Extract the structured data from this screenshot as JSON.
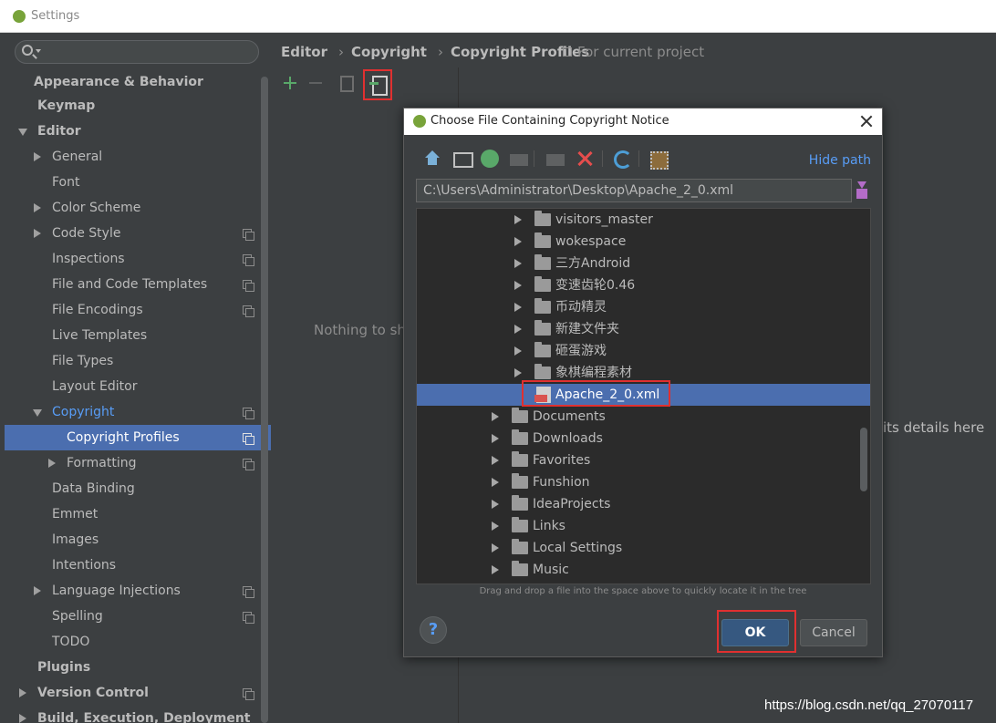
{
  "window": {
    "title": "Settings"
  },
  "sidebar": {
    "items": [
      {
        "label": "Appearance & Behavior"
      },
      {
        "label": "Keymap"
      },
      {
        "label": "Editor"
      },
      {
        "label": "General"
      },
      {
        "label": "Font"
      },
      {
        "label": "Color Scheme"
      },
      {
        "label": "Code Style"
      },
      {
        "label": "Inspections"
      },
      {
        "label": "File and Code Templates"
      },
      {
        "label": "File Encodings"
      },
      {
        "label": "Live Templates"
      },
      {
        "label": "File Types"
      },
      {
        "label": "Layout Editor"
      },
      {
        "label": "Copyright"
      },
      {
        "label": "Copyright Profiles"
      },
      {
        "label": "Formatting"
      },
      {
        "label": "Data Binding"
      },
      {
        "label": "Emmet"
      },
      {
        "label": "Images"
      },
      {
        "label": "Intentions"
      },
      {
        "label": "Language Injections"
      },
      {
        "label": "Spelling"
      },
      {
        "label": "TODO"
      },
      {
        "label": "Plugins"
      },
      {
        "label": "Version Control"
      },
      {
        "label": "Build, Execution, Deployment"
      }
    ]
  },
  "breadcrumb": {
    "editor": "Editor",
    "copyright": "Copyright",
    "profiles": "Copyright Profiles"
  },
  "main": {
    "for_project": "For current project",
    "nothing": "Nothing to sho",
    "details": "its details here"
  },
  "dialog": {
    "title": "Choose File Containing Copyright Notice",
    "hide_path": "Hide path",
    "path": "C:\\Users\\Administrator\\Desktop\\Apache_2_0.xml",
    "hint": "Drag and drop a file into the space above to quickly locate it in the tree",
    "help": "?",
    "ok": "OK",
    "cancel": "Cancel",
    "tree": [
      {
        "label": "visitors_master"
      },
      {
        "label": "wokespace"
      },
      {
        "label": "三方Android"
      },
      {
        "label": "变速齿轮0.46"
      },
      {
        "label": "币动精灵"
      },
      {
        "label": "新建文件夹"
      },
      {
        "label": "砸蛋游戏"
      },
      {
        "label": "象棋编程素材"
      },
      {
        "label": "Apache_2_0.xml"
      },
      {
        "label": "Documents"
      },
      {
        "label": "Downloads"
      },
      {
        "label": "Favorites"
      },
      {
        "label": "Funshion"
      },
      {
        "label": "IdeaProjects"
      },
      {
        "label": "Links"
      },
      {
        "label": "Local Settings"
      },
      {
        "label": "Music"
      }
    ]
  },
  "watermark": "https://blog.csdn.net/qq_27070117"
}
